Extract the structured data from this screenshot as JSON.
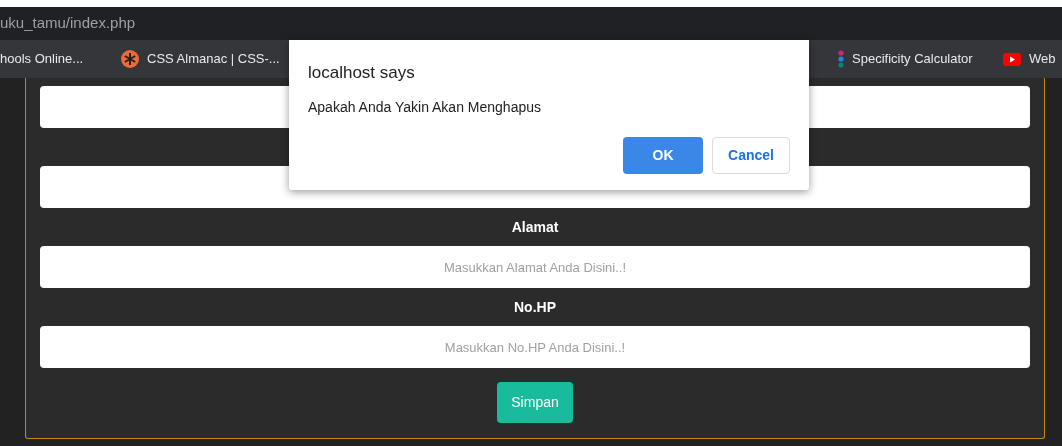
{
  "address_bar": {
    "url": "uku_tamu/index.php"
  },
  "bookmarks": [
    {
      "label": "hools Online...",
      "kind": "none"
    },
    {
      "label": "CSS Almanac | CSS-...",
      "kind": "asterisk"
    },
    {
      "label": "Specificity Calculator",
      "kind": "dots"
    },
    {
      "label": "Web",
      "kind": "play"
    }
  ],
  "form": {
    "fields": [
      {
        "kind": "input"
      },
      {
        "kind": "input"
      },
      {
        "kind": "input",
        "label": "Alamat",
        "placeholder": "Masukkan Alamat Anda Disini..!"
      },
      {
        "kind": "input",
        "label": "No.HP",
        "placeholder": "Masukkan No.HP Anda Disini..!"
      }
    ],
    "submit": "Simpan"
  },
  "dialog": {
    "title": "localhost says",
    "message": "Apakah Anda Yakin Akan Menghapus",
    "ok": "OK",
    "cancel": "Cancel"
  }
}
